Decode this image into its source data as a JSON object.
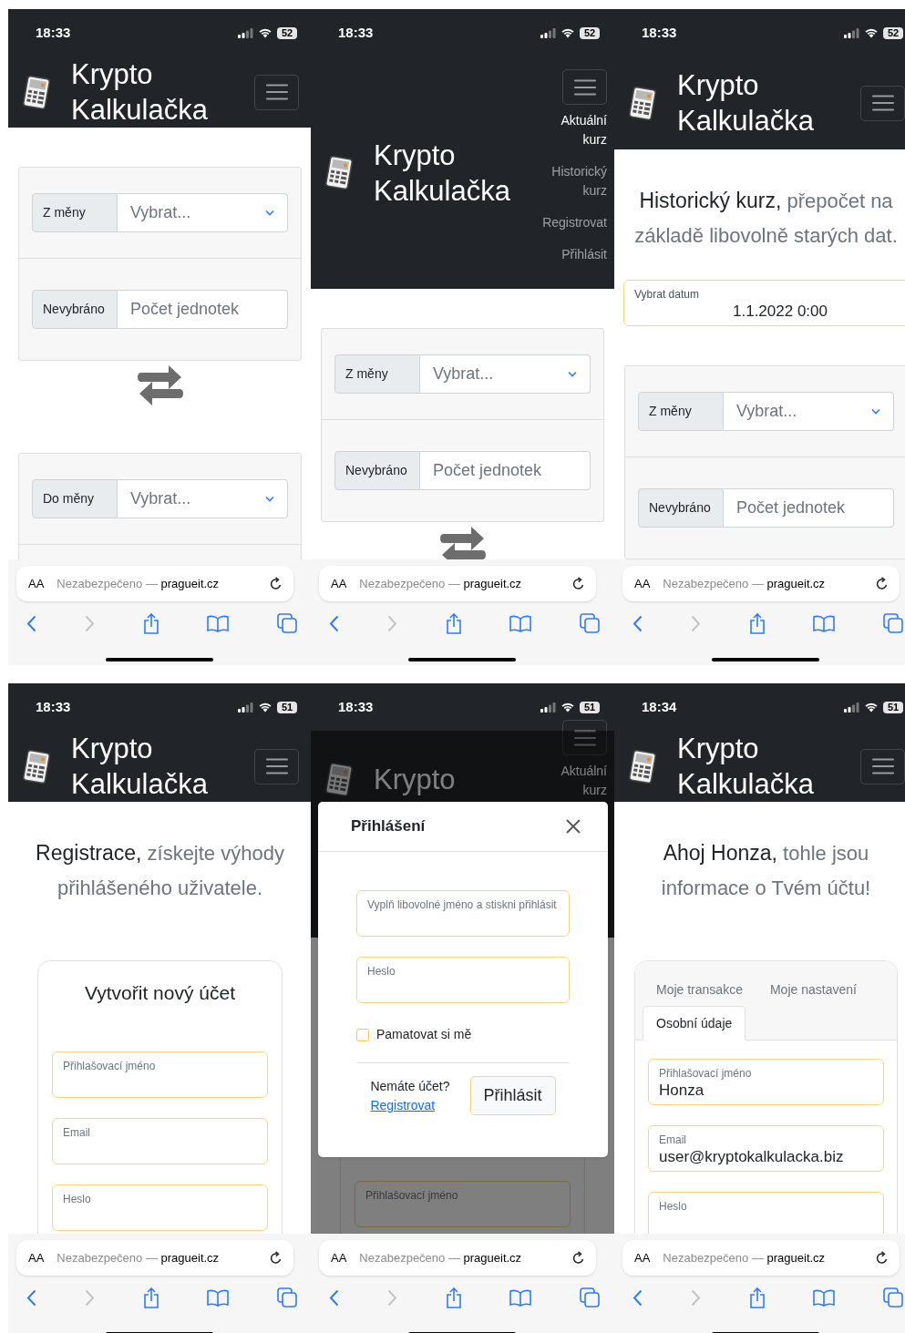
{
  "screens": [
    {
      "status_bar": {
        "time": "18:33",
        "battery": "52"
      },
      "navbar": {
        "title": "Krypto Kalkulačka",
        "menu_expanded": false
      },
      "content": [
        {
          "kind": "converter",
          "sections": [
            {
              "kind": "select",
              "label": "Z měny",
              "placeholder": "Vybrat..."
            },
            {
              "kind": "input",
              "label": "Nevybráno",
              "placeholder": "Počet jednotek"
            }
          ]
        },
        {
          "kind": "swap"
        },
        {
          "kind": "converter",
          "sections": [
            {
              "kind": "select",
              "label": "Do měny",
              "placeholder": "Vybrat..."
            },
            {
              "kind": "empty"
            }
          ]
        }
      ],
      "browser": {
        "text_size": "AA",
        "security": "Nezabezpečeno — ",
        "domain": "pragueit.cz",
        "forward_disabled": true
      }
    },
    {
      "status_bar": {
        "time": "18:33",
        "battery": "52"
      },
      "navbar": {
        "title": "Krypto Kalkulačka",
        "menu_expanded": true,
        "menu_items": [
          {
            "label": "Aktuální kurz",
            "selected": true
          },
          {
            "label": "Historický kurz",
            "selected": false
          },
          {
            "label": "Registrovat",
            "selected": false
          },
          {
            "label": "Přihlásit",
            "selected": false
          }
        ]
      },
      "content": [
        {
          "kind": "converter",
          "sections": [
            {
              "kind": "select",
              "label": "Z měny",
              "placeholder": "Vybrat..."
            },
            {
              "kind": "input",
              "label": "Nevybráno",
              "placeholder": "Počet jednotek"
            }
          ]
        },
        {
          "kind": "swap"
        }
      ],
      "browser": {
        "text_size": "AA",
        "security": "Nezabezpečeno — ",
        "domain": "pragueit.cz",
        "forward_disabled": true
      }
    },
    {
      "status_bar": {
        "time": "18:33",
        "battery": "52"
      },
      "navbar": {
        "title": "Krypto Kalkulačka",
        "menu_expanded": false
      },
      "content": [
        {
          "kind": "heading",
          "lead": "Historický kurz,",
          "text": "přepočet na základě libovolně starých dat."
        },
        {
          "kind": "date_field",
          "label": "Vybrat datum",
          "value": "1.1.2022 0:00"
        },
        {
          "kind": "converter",
          "sections": [
            {
              "kind": "select",
              "label": "Z měny",
              "placeholder": "Vybrat..."
            },
            {
              "kind": "input",
              "label": "Nevybráno",
              "placeholder": "Počet jednotek"
            }
          ]
        }
      ],
      "browser": {
        "text_size": "AA",
        "security": "Nezabezpečeno — ",
        "domain": "pragueit.cz",
        "forward_disabled": true
      }
    },
    {
      "status_bar": {
        "time": "18:33",
        "battery": "51"
      },
      "navbar": {
        "title": "Krypto Kalkulačka",
        "menu_expanded": false
      },
      "content": [
        {
          "kind": "heading",
          "lead": "Registrace,",
          "text": "získejte výhody přihlášeného uživatele."
        },
        {
          "kind": "register_card",
          "title": "Vytvořit nový účet",
          "fields": [
            {
              "label": "Přihlašovací jméno"
            },
            {
              "label": "Email"
            },
            {
              "label": "Heslo"
            }
          ]
        }
      ],
      "browser": {
        "text_size": "AA",
        "security": "Nezabezpečeno — ",
        "domain": "pragueit.cz",
        "forward_disabled": true
      }
    },
    {
      "status_bar": {
        "time": "18:33",
        "battery": "51"
      },
      "navbar": {
        "title": "Krypto",
        "menu_expanded": true,
        "menu_items": [
          {
            "label": "Aktuální kurz",
            "selected": true
          }
        ]
      },
      "content": [
        {
          "kind": "register_card",
          "fields": [
            {
              "label": "Přihlašovací jméno"
            }
          ]
        }
      ],
      "modal": {
        "title": "Přihlášení",
        "fields": [
          {
            "label": "Vyplň libovolné jméno a stiskni přihlásit"
          },
          {
            "label": "Heslo"
          }
        ],
        "remember": {
          "label": "Pamatovat si mě",
          "checked": false
        },
        "prompt": "Nemáte účet?",
        "link": "Registrovat",
        "button": "Přihlásit"
      },
      "browser": {
        "text_size": "AA",
        "security": "Nezabezpečeno — ",
        "domain": "pragueit.cz",
        "forward_disabled": true
      }
    },
    {
      "status_bar": {
        "time": "18:34",
        "battery": "51"
      },
      "navbar": {
        "title": "Krypto Kalkulačka",
        "menu_expanded": false
      },
      "content": [
        {
          "kind": "heading",
          "lead": "Ahoj Honza,",
          "text": "tohle jsou informace o Tvém účtu!"
        },
        {
          "kind": "account_card",
          "tabs": [
            {
              "label": "Moje transakce",
              "selected": false
            },
            {
              "label": "Moje nastavení",
              "selected": false
            },
            {
              "label": "Osobní údaje",
              "selected": true
            }
          ],
          "fields": [
            {
              "label": "Přihlašovací jméno",
              "value": "Honza"
            },
            {
              "label": "Email",
              "value": "user@kryptokalkulacka.biz"
            },
            {
              "label": "Heslo"
            }
          ]
        }
      ],
      "browser": {
        "text_size": "AA",
        "security": "Nezabezpečeno — ",
        "domain": "pragueit.cz",
        "forward_disabled": true
      }
    }
  ]
}
